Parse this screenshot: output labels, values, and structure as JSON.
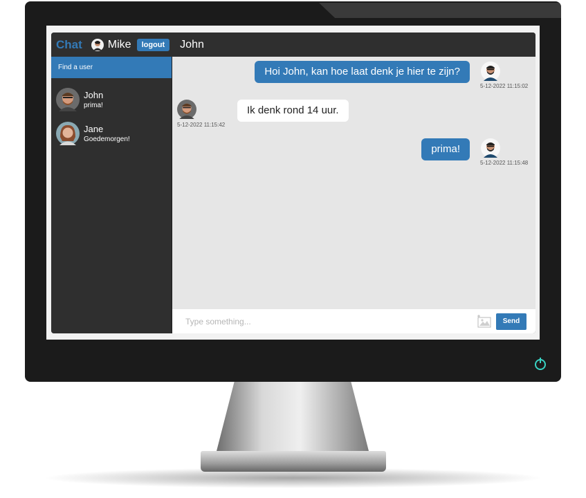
{
  "header": {
    "brand": "Chat",
    "me_name": "Mike",
    "logout_label": "logout",
    "chat_with": "John"
  },
  "sidebar": {
    "find_label": "Find a user",
    "users": [
      {
        "name": "John",
        "last_message": "prima!"
      },
      {
        "name": "Jane",
        "last_message": "Goedemorgen!"
      }
    ]
  },
  "messages": [
    {
      "direction": "out",
      "text": "Hoi John, kan hoe laat denk je hier te zijn?",
      "timestamp": "5-12-2022 11:15:02"
    },
    {
      "direction": "in",
      "text": "Ik denk rond 14 uur.",
      "timestamp": "5-12-2022 11:15:42"
    },
    {
      "direction": "out",
      "text": "prima!",
      "timestamp": "5-12-2022 11:15:48"
    }
  ],
  "composer": {
    "placeholder": "Type something...",
    "send_label": "Send"
  },
  "icons": {
    "power": "power-icon",
    "image": "image-icon"
  },
  "colors": {
    "accent": "#337ab7",
    "power": "#39d3c4"
  }
}
